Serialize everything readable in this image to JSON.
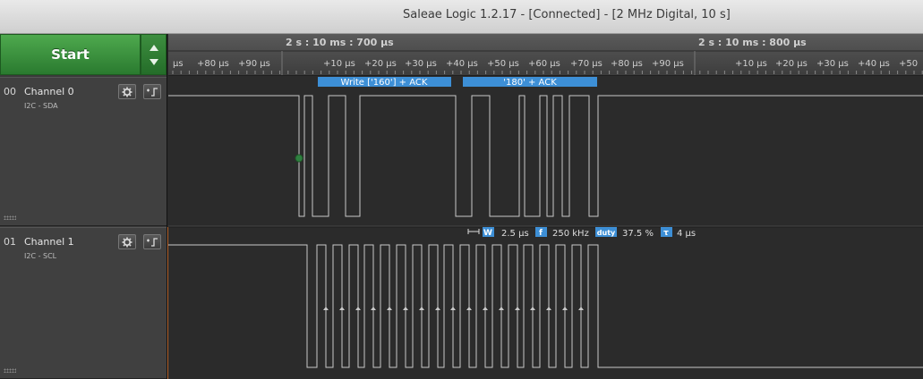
{
  "window": {
    "title": "Saleae Logic 1.2.17 - [Connected] - [2 MHz Digital, 10 s]"
  },
  "toolbar": {
    "start_label": "Start"
  },
  "timebar": {
    "major_labels": [
      "2 s : 10 ms : 700 µs",
      "2 s : 10 ms : 800 µs"
    ],
    "minor_labels": [
      "µs",
      "+80 µs",
      "+90 µs",
      "+10 µs",
      "+20 µs",
      "+30 µs",
      "+40 µs",
      "+50 µs",
      "+60 µs",
      "+70 µs",
      "+80 µs",
      "+90 µs",
      "+10 µs",
      "+20 µs",
      "+30 µs",
      "+40 µs",
      "+50"
    ]
  },
  "channels": [
    {
      "index": "00",
      "name": "Channel 0",
      "protocol": "I2C - SDA"
    },
    {
      "index": "01",
      "name": "Channel 1",
      "protocol": "I2C - SCL"
    }
  ],
  "annotations": [
    "Write ['160'] + ACK",
    "'180' + ACK"
  ],
  "measurements": {
    "width_badge": "W",
    "width_value": "2.5 µs",
    "freq_badge": "f",
    "freq_value": "250 kHz",
    "duty_badge": "duty",
    "duty_value": "37.5 %",
    "period_badge": "τ",
    "period_value": "4 µs"
  },
  "colors": {
    "annotation_bg": "#3d8fd6",
    "signal": "#c8c8c8",
    "accent": "#2e8b3a",
    "marker": "#2f8040",
    "channel_strip": "#b4632d"
  },
  "icons": {
    "settings": "gear-icon",
    "trigger": "trigger-edge-icon"
  }
}
